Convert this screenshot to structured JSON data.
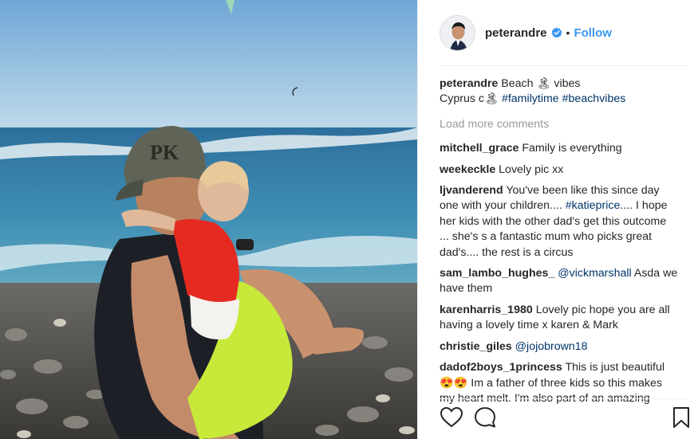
{
  "post": {
    "image_alt": "Man in cap and child on a pebble beach by the sea",
    "cap_letters": "PK"
  },
  "header": {
    "username": "peterandre",
    "separator": "•",
    "follow_label": "Follow",
    "verified_color": "#3897f0"
  },
  "caption": {
    "username": "peterandre",
    "text_line1": "Beach 🏝 vibes",
    "text_line2": "Cyprus c🏝",
    "hashtag1": "#familytime",
    "hashtag2": "#beachvibes"
  },
  "load_more_label": "Load more comments",
  "comments": [
    {
      "user": "mitchell_grace",
      "text": "Family is everything"
    },
    {
      "user": "weekeckle",
      "text": "Lovely pic xx"
    },
    {
      "user": "ljvanderend",
      "text_before": "You've been like this since day one with your children.... ",
      "mention": "#katieprice",
      "text_after": ".... I hope her kids with the other dad's get this outcome ... she's s a fantastic mum who picks great dad's.... the rest is a circus"
    },
    {
      "user": "sam_lambo_hughes_",
      "mention": "@vickmarshall",
      "text_after": " Asda we have them"
    },
    {
      "user": "karenharris_1980",
      "text": "Lovely pic hope you are all having a lovely time x karen & Mark"
    },
    {
      "user": "christie_giles",
      "mention": "@jojobrown18"
    },
    {
      "user": "dadof2boys_1princess",
      "text": "This is just beautiful 😍😍 Im a father of three kids so this makes my heart melt. I'm also part of an amazing"
    }
  ],
  "actions": {
    "like_icon": "heart-outline-icon",
    "comment_icon": "speech-bubble-icon",
    "save_icon": "bookmark-icon"
  },
  "colors": {
    "link": "#003569",
    "follow": "#3897f0",
    "muted": "#999999"
  }
}
